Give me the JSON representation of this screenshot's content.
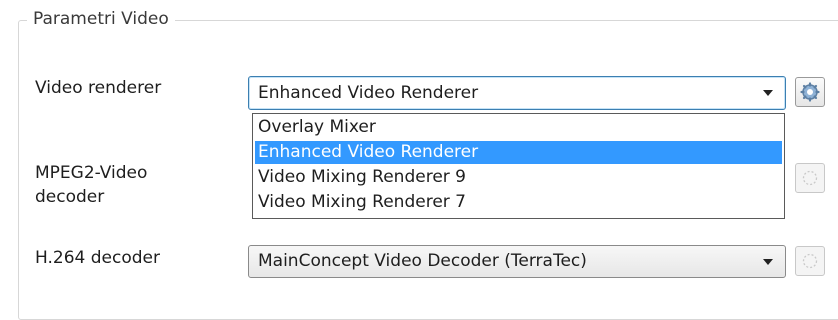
{
  "group": {
    "legend": "Parametri Video"
  },
  "rows": {
    "video_renderer": {
      "label": "Video renderer",
      "value": "Enhanced Video Renderer"
    },
    "mpeg2": {
      "label_line1": "MPEG2-Video",
      "label_line2": "decoder"
    },
    "h264": {
      "label": "H.264 decoder",
      "value": "MainConcept Video Decoder (TerraTec)"
    }
  },
  "dropdown": {
    "options": [
      "Overlay Mixer",
      "Enhanced Video Renderer",
      "Video Mixing Renderer 9",
      "Video Mixing Renderer 7"
    ],
    "selected": "Enhanced Video Renderer"
  },
  "icons": {
    "settings": "gear-icon"
  },
  "colors": {
    "selection": "#3399ff",
    "combo_focus_border": "#3c7fb1"
  }
}
